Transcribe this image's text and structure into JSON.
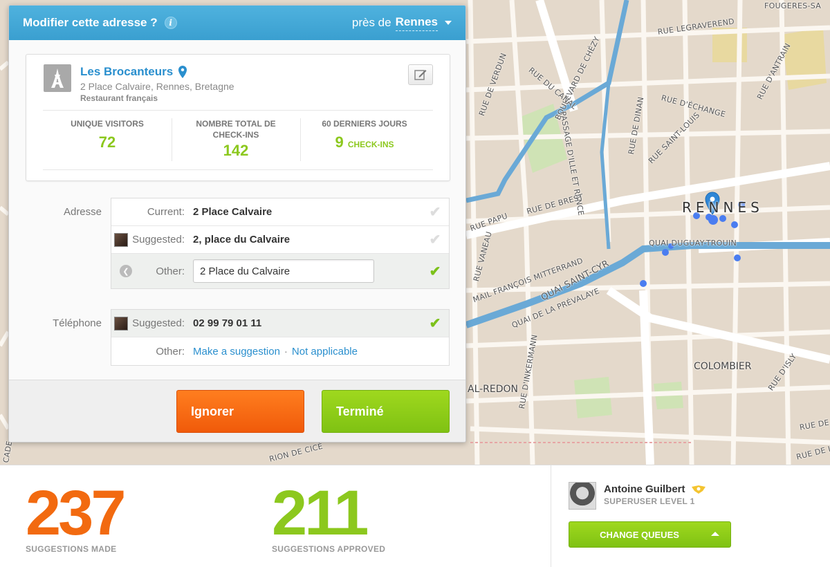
{
  "panel": {
    "title": "Modifier cette adresse ?",
    "near_prefix": "près de",
    "near_city": "Rennes"
  },
  "venue": {
    "name": "Les Brocanteurs",
    "address": "2 Place Calvaire, Rennes, Bretagne",
    "category": "Restaurant français",
    "stats": [
      {
        "label": "UNIQUE VISITORS",
        "value": "72",
        "unit": ""
      },
      {
        "label": "NOMBRE TOTAL DE CHECK-INS",
        "value": "142",
        "unit": ""
      },
      {
        "label": "60 DERNIERS JOURS",
        "value": "9",
        "unit": "CHECK-INS"
      }
    ]
  },
  "address_section": {
    "label": "Adresse",
    "current_key": "Current:",
    "current_value": "2 Place Calvaire",
    "suggested_key": "Suggested:",
    "suggested_value": "2, place du Calvaire",
    "other_key": "Other:",
    "other_value": "2 Place du Calvaire"
  },
  "phone_section": {
    "label": "Téléphone",
    "suggested_key": "Suggested:",
    "suggested_value": "02 99 79 01 11",
    "other_key": "Other:",
    "make_suggestion": "Make a suggestion",
    "separator": "·",
    "not_applicable": "Not applicable"
  },
  "buttons": {
    "ignore": "Ignorer",
    "done": "Terminé"
  },
  "bottom": {
    "made_count": "237",
    "made_label": "SUGGESTIONS MADE",
    "approved_count": "211",
    "approved_label": "SUGGESTIONS APPROVED",
    "user_name": "Antoine Guilbert",
    "user_level": "SUPERUSER LEVEL 1",
    "change_queues": "CHANGE QUEUES"
  },
  "map": {
    "city_label": "RENNES",
    "districts": [
      "COLOMBIER",
      "AL-REDON"
    ],
    "streets": [
      "FOUGERES-SA",
      "RUE LEGRAVEREND",
      "RUE D'ANTRAIN",
      "RUE DE VERDUN",
      "BOULEVARD DE CHÉZY",
      "RUE DU CANAL",
      "RUE D'ÉCHANGE",
      "RUE DE DINAN",
      "RUE SAINT-LOUIS",
      "PASSAGE D'ILLE ET RANCE",
      "RUE DE BREST",
      "RUE PAPU",
      "RUE VANEAU",
      "QUAI DUGUAY-TROUIN",
      "MAIL FRANÇOIS MITTERRAND",
      "QUAI SAINT-CYR",
      "QUAI DE LA PRÉVALAYE",
      "RUE D'INKERMANN",
      "RUE D'ISLY",
      "RION DE CICÉ",
      "RUE DE L'",
      "RUE DE LA",
      "CADE"
    ]
  },
  "colors": {
    "header_blue": "#3a9fd0",
    "link_blue": "#2a8fce",
    "green": "#8cc81e",
    "orange": "#f26a10",
    "water": "#7ab3d9"
  }
}
